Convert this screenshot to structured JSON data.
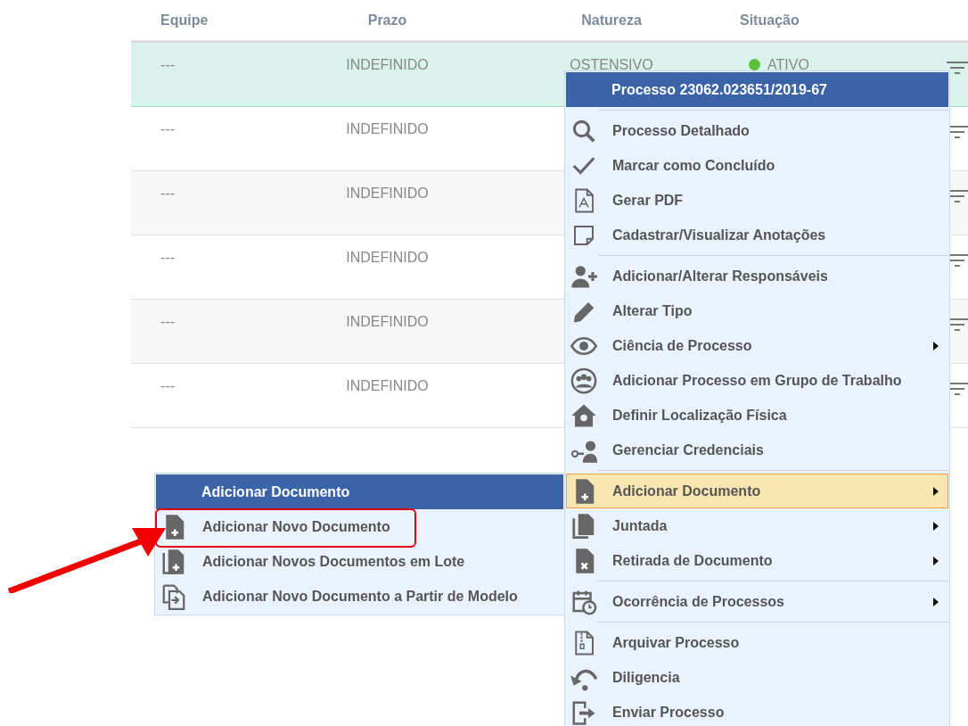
{
  "table": {
    "columns": [
      "Equipe",
      "Prazo",
      "Natureza",
      "Situação"
    ],
    "rows": [
      {
        "equipe": "---",
        "prazo": "INDEFINIDO",
        "natureza": "OSTENSIVO",
        "situacao": "ATIVO",
        "color": "#5cc03e",
        "selected": true
      },
      {
        "equipe": "---",
        "prazo": "INDEFINIDO",
        "selected": false
      },
      {
        "equipe": "---",
        "prazo": "INDEFINIDO",
        "selected": false
      },
      {
        "equipe": "---",
        "prazo": "INDEFINIDO",
        "selected": false
      },
      {
        "equipe": "---",
        "prazo": "INDEFINIDO",
        "selected": false
      },
      {
        "equipe": "---",
        "prazo": "INDEFINIDO",
        "selected": false
      }
    ]
  },
  "context_menu": {
    "title": "Processo 23062.023651/2019-67",
    "groups": [
      [
        {
          "kind": "search",
          "label": "Processo Detalhado",
          "has_submenu": false,
          "selected": false
        },
        {
          "kind": "check",
          "label": "Marcar como Concluído",
          "has_submenu": false,
          "selected": false
        },
        {
          "kind": "pdf-file",
          "label": "Gerar PDF",
          "has_submenu": false,
          "selected": false
        },
        {
          "kind": "note",
          "label": "Cadastrar/Visualizar Anotações",
          "has_submenu": false,
          "selected": false
        }
      ],
      [
        {
          "kind": "add-user",
          "label": "Adicionar/Alterar Responsáveis",
          "has_submenu": false,
          "selected": false
        },
        {
          "kind": "pencil",
          "label": "Alterar Tipo",
          "has_submenu": false,
          "selected": false
        },
        {
          "kind": "eye",
          "label": "Ciência de Processo",
          "has_submenu": true,
          "selected": false
        },
        {
          "kind": "group",
          "label": "Adicionar Processo em Grupo de Trabalho",
          "has_submenu": false,
          "selected": false
        },
        {
          "kind": "house-pin",
          "label": "Definir Localização Física",
          "has_submenu": false,
          "selected": false
        },
        {
          "kind": "key-user",
          "label": "Gerenciar Credenciais",
          "has_submenu": false,
          "selected": false
        }
      ],
      [
        {
          "kind": "add-file",
          "label": "Adicionar Documento",
          "has_submenu": true,
          "selected": true
        },
        {
          "kind": "files",
          "label": "Juntada",
          "has_submenu": true,
          "selected": false
        },
        {
          "kind": "remove-file",
          "label": "Retirada de Documento",
          "has_submenu": true,
          "selected": false
        }
      ],
      [
        {
          "kind": "calendar-clock",
          "label": "Ocorrência de Processos",
          "has_submenu": true,
          "selected": false
        }
      ],
      [
        {
          "kind": "zip-file",
          "label": "Arquivar Processo",
          "has_submenu": false,
          "selected": false
        },
        {
          "kind": "undo",
          "label": "Diligencia",
          "has_submenu": false,
          "selected": false
        },
        {
          "kind": "exit",
          "label": "Enviar Processo",
          "has_submenu": false,
          "selected": false
        }
      ]
    ]
  },
  "submenu": {
    "title": "Adicionar Documento",
    "items": [
      {
        "kind": "add-file",
        "label": "Adicionar Novo Documento",
        "annotated": true
      },
      {
        "kind": "add-files",
        "label": "Adicionar Novos Documentos em Lote",
        "annotated": false
      },
      {
        "kind": "copy-file",
        "label": "Adicionar Novo Documento a Partir de Modelo",
        "annotated": false
      }
    ]
  }
}
